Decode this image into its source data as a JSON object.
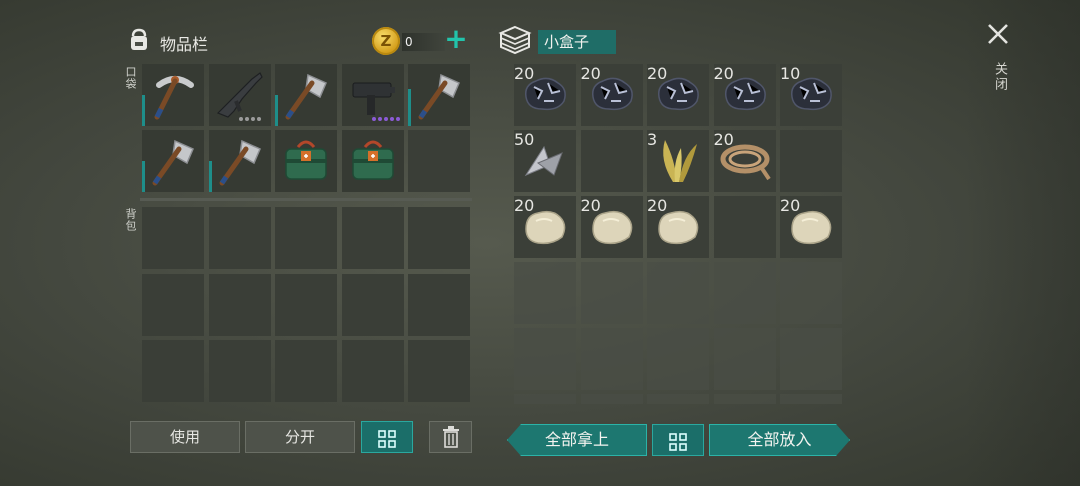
{
  "inventory": {
    "title": "物品栏",
    "icon": "backpack-icon",
    "gold_value": "0",
    "gold_icon": "gold-coin-icon",
    "add_icon": "plus-icon",
    "pocket_label": "口袋",
    "backpack_label": "背包",
    "pocket_items": [
      {
        "name": "pickaxe-icon",
        "durability": 0.5
      },
      {
        "name": "assault-rifle-icon",
        "rarity_dots": 4,
        "dot_color": "#9b9b9b"
      },
      {
        "name": "hatchet-icon",
        "durability": 0.5
      },
      {
        "name": "uzi-smg-icon",
        "rarity_dots": 5,
        "dot_color": "#8b5bd6"
      },
      {
        "name": "hatchet-icon",
        "durability": 0.6
      },
      {
        "name": "hatchet-icon",
        "durability": 0.5
      },
      {
        "name": "hatchet-icon",
        "durability": 0.5
      },
      {
        "name": "medkit-bag-icon"
      },
      {
        "name": "medkit-bag-icon"
      },
      {
        "name": "empty"
      }
    ]
  },
  "container": {
    "title": "小盒子",
    "icon": "box-icon",
    "items": [
      {
        "name": "iron-ore-icon",
        "count": "20"
      },
      {
        "name": "iron-ore-icon",
        "count": "20"
      },
      {
        "name": "iron-ore-icon",
        "count": "20"
      },
      {
        "name": "iron-ore-icon",
        "count": "20"
      },
      {
        "name": "iron-ore-icon",
        "count": "10"
      },
      {
        "name": "metal-scrap-icon",
        "count": "50"
      },
      {
        "name": "empty",
        "count": ""
      },
      {
        "name": "plant-fiber-icon",
        "count": "3"
      },
      {
        "name": "rope-icon",
        "count": "20"
      },
      {
        "name": "empty",
        "count": ""
      },
      {
        "name": "stone-icon",
        "count": "20"
      },
      {
        "name": "stone-icon",
        "count": "20"
      },
      {
        "name": "stone-icon",
        "count": "20"
      },
      {
        "name": "empty",
        "count": ""
      },
      {
        "name": "stone-icon",
        "count": "20"
      }
    ]
  },
  "close": {
    "label": "关闭",
    "icon": "close-icon"
  },
  "buttons": {
    "use": "使用",
    "split": "分开",
    "sort_icon": "grid-sort-icon",
    "trash_icon": "trash-icon",
    "take_all": "全部拿上",
    "put_all": "全部放入"
  },
  "colors": {
    "accent": "#1d7770",
    "accent_border": "#2bb3a8",
    "plus": "#22c3ab"
  }
}
